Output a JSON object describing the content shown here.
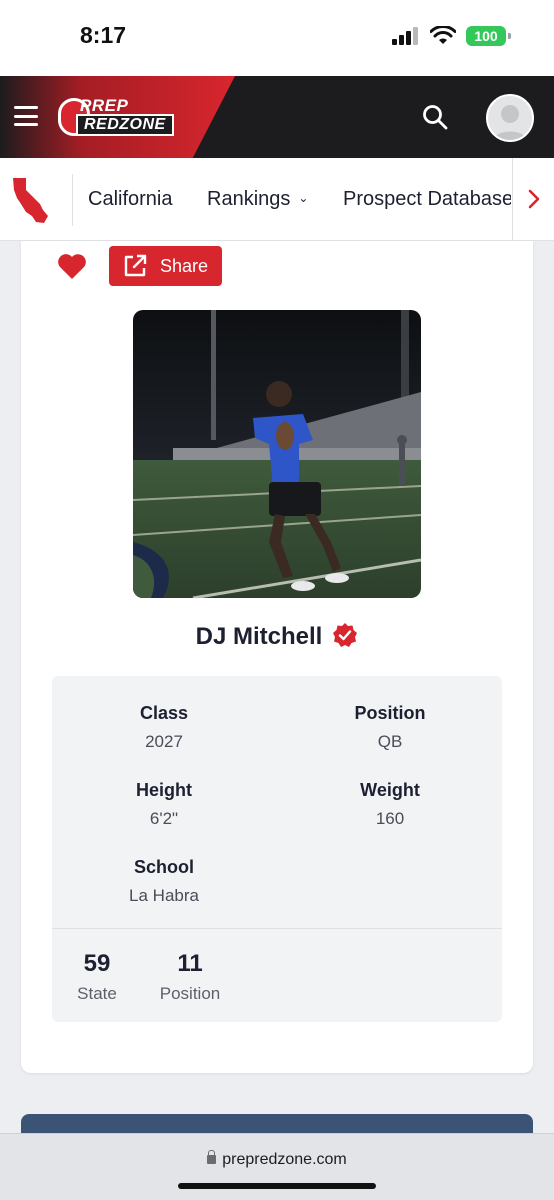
{
  "status_bar": {
    "time": "8:17",
    "battery": "100"
  },
  "header": {
    "brand_top": "PREP",
    "brand_bottom": "REDZONE",
    "search_icon": "search-icon",
    "avatar_icon": "user-avatar-icon"
  },
  "subnav": {
    "state_icon": "california-map-icon",
    "items": [
      {
        "label": "California"
      },
      {
        "label": "Rankings",
        "icon": "chevron-down-icon"
      },
      {
        "label": "Prospect Database"
      }
    ],
    "next_icon": "chevron-right-icon"
  },
  "actions": {
    "favorite_icon": "heart-icon",
    "share_label": "Share",
    "share_icon": "external-share-icon"
  },
  "player": {
    "name": "DJ Mitchell",
    "verified_icon": "verified-badge-icon",
    "details": [
      {
        "label": "Class",
        "value": "2027"
      },
      {
        "label": "Position",
        "value": "QB"
      },
      {
        "label": "Height",
        "value": "6'2\""
      },
      {
        "label": "Weight",
        "value": "160"
      },
      {
        "label": "School",
        "value": "La Habra"
      }
    ],
    "rankings": [
      {
        "number": "59",
        "label": "State"
      },
      {
        "number": "11",
        "label": "Position"
      }
    ]
  },
  "browser": {
    "url": "prepredzone.com"
  },
  "colors": {
    "brand_red": "#d8262e",
    "header_dark": "#1c1c1e",
    "verified_red": "#d8262e"
  }
}
